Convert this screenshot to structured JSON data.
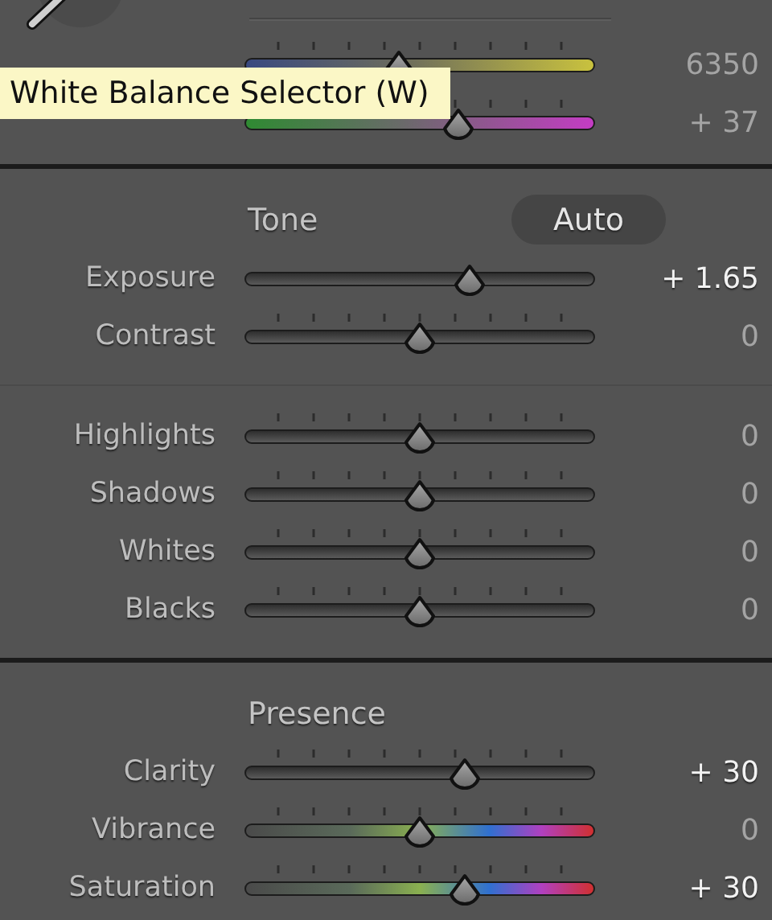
{
  "tooltip": {
    "text": "White Balance Selector (W)"
  },
  "sections": [
    {
      "kind": "wb",
      "groups": [
        [
          {
            "value": "6350",
            "level": 0.44,
            "kind": "temp",
            "ticks": true,
            "highlighted": false
          },
          {
            "value": "+ 37",
            "level": 0.61,
            "kind": "tint",
            "ticks": true,
            "highlighted": false
          }
        ]
      ]
    },
    {
      "kind": "panel",
      "title": "Tone",
      "button": "Auto",
      "groups": [
        [
          {
            "label": "Exposure",
            "value": "+ 1.65",
            "level": 0.64,
            "kind": "plain",
            "ticks": false,
            "highlighted": true
          },
          {
            "label": "Contrast",
            "value": "0",
            "level": 0.5,
            "kind": "plain",
            "ticks": true,
            "highlighted": false
          }
        ],
        [
          {
            "label": "Highlights",
            "value": "0",
            "level": 0.5,
            "kind": "plain",
            "ticks": true,
            "highlighted": false
          },
          {
            "label": "Shadows",
            "value": "0",
            "level": 0.5,
            "kind": "plain",
            "ticks": true,
            "highlighted": false
          },
          {
            "label": "Whites",
            "value": "0",
            "level": 0.5,
            "kind": "plain",
            "ticks": true,
            "highlighted": false
          },
          {
            "label": "Blacks",
            "value": "0",
            "level": 0.5,
            "kind": "plain",
            "ticks": true,
            "highlighted": false
          }
        ]
      ]
    },
    {
      "kind": "panel",
      "title": "Presence",
      "groups": [
        [
          {
            "label": "Clarity",
            "value": "+ 30",
            "level": 0.63,
            "kind": "plain",
            "ticks": true,
            "highlighted": true
          },
          {
            "label": "Vibrance",
            "value": "0",
            "level": 0.5,
            "kind": "color",
            "ticks": true,
            "highlighted": false
          },
          {
            "label": "Saturation",
            "value": "+ 30",
            "level": 0.63,
            "kind": "color",
            "ticks": true,
            "highlighted": true
          }
        ]
      ]
    }
  ]
}
